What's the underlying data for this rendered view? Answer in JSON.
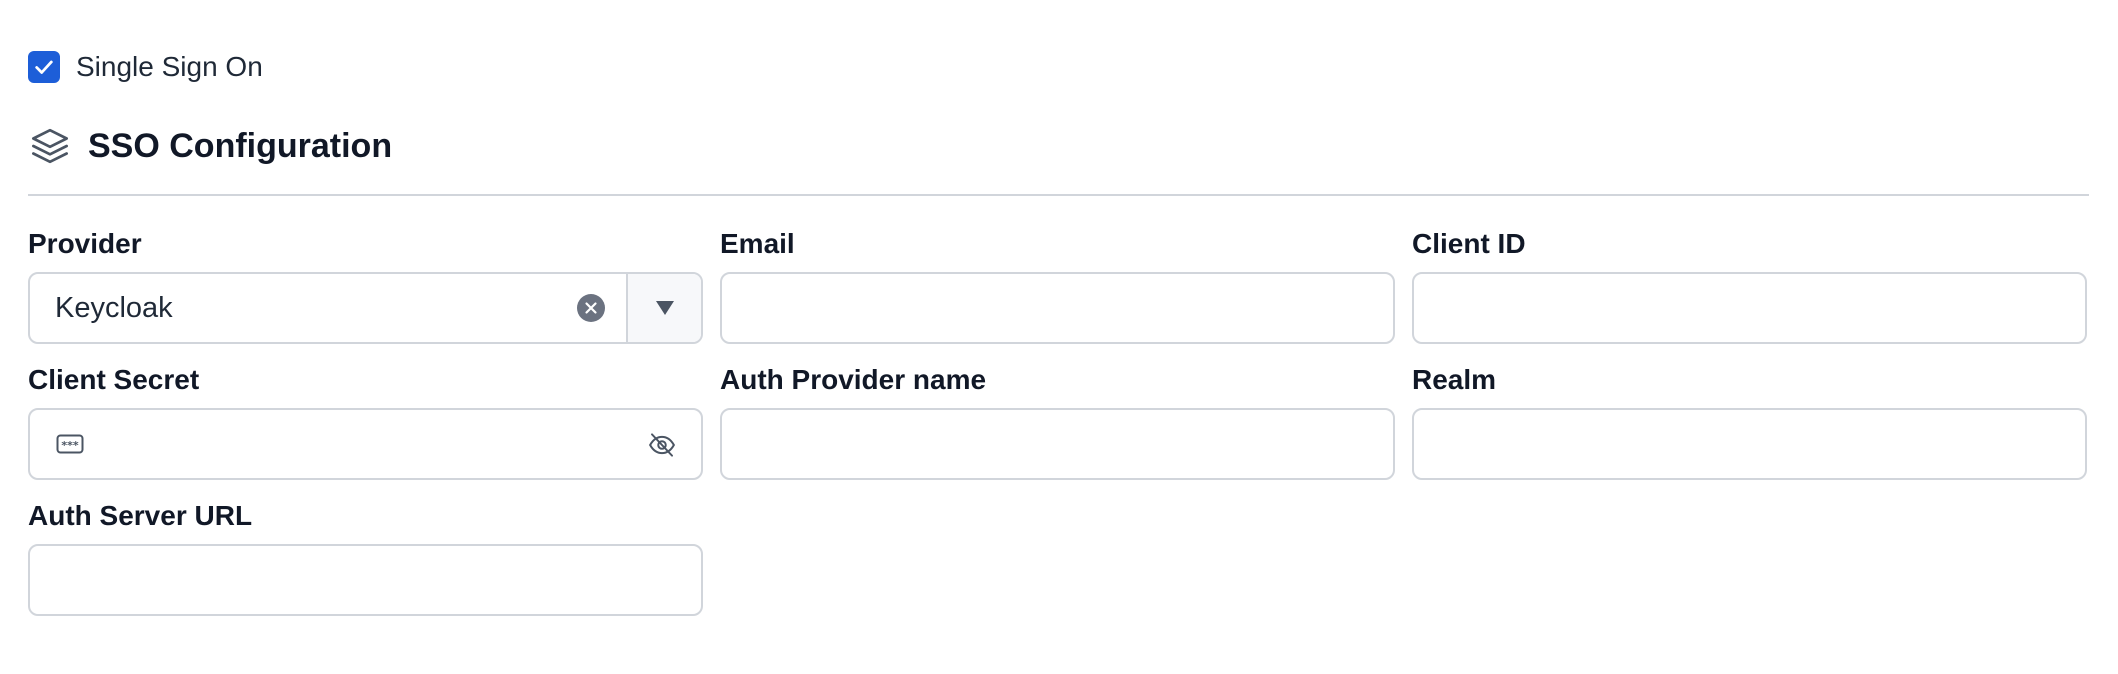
{
  "sso_toggle": {
    "label": "Single Sign On",
    "checked": true
  },
  "section": {
    "title": "SSO Configuration",
    "icon": "layers-icon"
  },
  "fields": {
    "provider": {
      "label": "Provider",
      "value": "Keycloak"
    },
    "email": {
      "label": "Email",
      "value": ""
    },
    "client_id": {
      "label": "Client ID",
      "value": ""
    },
    "client_secret": {
      "label": "Client Secret",
      "value": ""
    },
    "auth_provider_name": {
      "label": "Auth Provider name",
      "value": ""
    },
    "realm": {
      "label": "Realm",
      "value": ""
    },
    "auth_server_url": {
      "label": "Auth Server URL",
      "value": ""
    }
  },
  "colors": {
    "accent": "#1d5ed8",
    "border": "#d1d5db",
    "text": "#1f2937"
  }
}
